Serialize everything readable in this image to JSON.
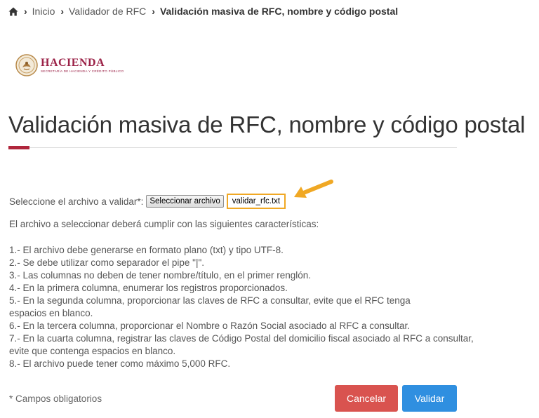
{
  "breadcrumb": {
    "home_icon": "home-icon",
    "items": [
      "Inicio",
      "Validador de RFC"
    ],
    "current": "Validación masiva de RFC, nombre y código postal"
  },
  "logo": {
    "name": "HACIENDA",
    "subtitle": "SECRETARÍA DE HACIENDA Y CRÉDITO PÚBLICO",
    "color": "#9b2247"
  },
  "title": "Validación masiva de RFC, nombre y código postal",
  "accent_color": "#b0263c",
  "file": {
    "label": "Seleccione el archivo a validar*:",
    "button_label": "Seleccionar archivo",
    "filename": "validar_rfc.txt",
    "highlight_color": "#f0a824"
  },
  "intro": "El archivo a seleccionar deberá cumplir con las siguientes características:",
  "requirements": [
    "1.- El archivo debe generarse en formato plano (txt) y tipo UTF-8.",
    "2.- Se debe utilizar como separador el pipe \"|\".",
    "3.- Las columnas no deben de tener nombre/título, en el primer renglón.",
    "4.- En la primera columna, enumerar los registros proporcionados.",
    "5.- En la segunda columna, proporcionar las claves de RFC a consultar, evite que el RFC tenga",
    "espacios en blanco.",
    "6.- En la tercera columna, proporcionar el Nombre o Razón Social asociado al RFC a consultar.",
    "7.- En la cuarta columna, registrar las claves de Código Postal del domicilio fiscal asociado al RFC a consultar,",
    "evite que contenga espacios en blanco.",
    "8.- El archivo puede tener como máximo 5,000 RFC."
  ],
  "required_note": "* Campos obligatorios",
  "buttons": {
    "cancel": "Cancelar",
    "validate": "Validar",
    "cancel_color": "#d9534f",
    "validate_color": "#2f8fe0"
  }
}
